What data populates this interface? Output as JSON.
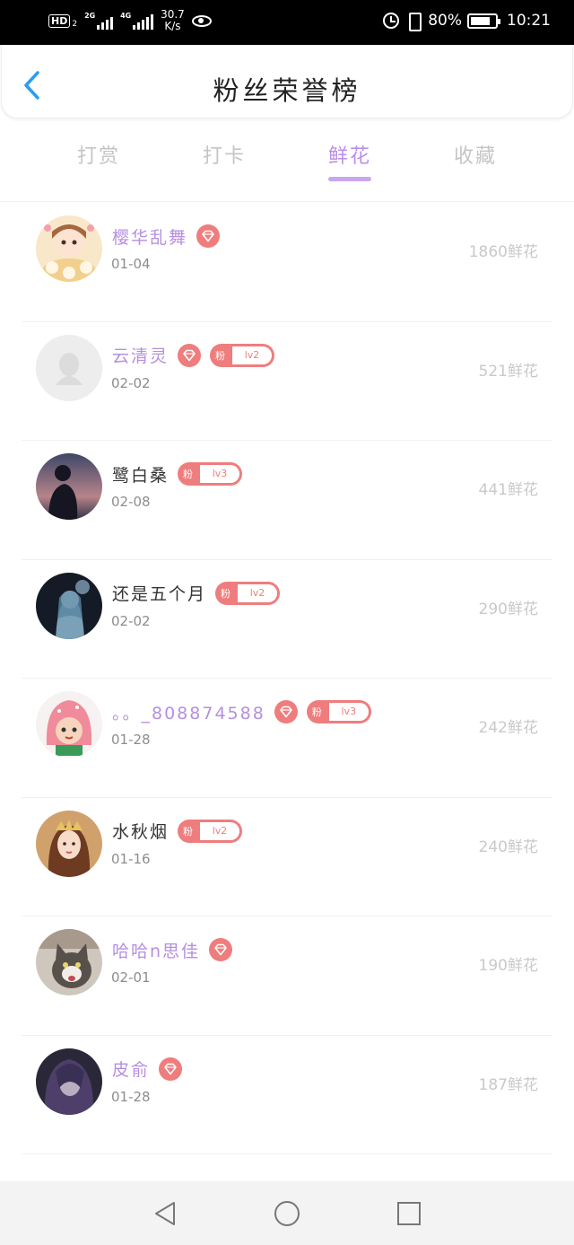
{
  "status_bar": {
    "hd": "HD",
    "sim2": "2",
    "net1": "2G",
    "net2": "4G",
    "speed_value": "30.7",
    "speed_unit": "K/s",
    "battery_pct": "80%",
    "battery_level": 0.8,
    "time": "10:21"
  },
  "header": {
    "title": "粉丝荣誉榜",
    "back_icon": "chevron-left-icon"
  },
  "tabs": [
    {
      "label": "打赏",
      "active": false
    },
    {
      "label": "打卡",
      "active": false
    },
    {
      "label": "鲜花",
      "active": true
    },
    {
      "label": "收藏",
      "active": false
    }
  ],
  "colors": {
    "accent_purple": "#b58fe0",
    "tab_indicator": "#c8a7ef",
    "badge_red": "#ef7d7d",
    "muted_gray": "#c9c9c9"
  },
  "fans": [
    {
      "name": "樱华乱舞",
      "name_color": "purple",
      "diamond": true,
      "fan_level": null,
      "date": "01-04",
      "count": "1860鲜花",
      "avatar": "cartoon-girl-avatar"
    },
    {
      "name": "云清灵",
      "name_color": "purple",
      "diamond": true,
      "fan_level": "lv2",
      "date": "02-02",
      "count": "521鲜花",
      "avatar": "default-penguin-avatar"
    },
    {
      "name": "鹭白桑",
      "name_color": "dark",
      "diamond": false,
      "fan_level": "lv3",
      "date": "02-08",
      "count": "441鲜花",
      "avatar": "sunset-silhouette-avatar"
    },
    {
      "name": "还是五个月",
      "name_color": "dark",
      "diamond": false,
      "fan_level": "lv2",
      "date": "02-02",
      "count": "290鲜花",
      "avatar": "anime-night-avatar"
    },
    {
      "name": "。。_808874588",
      "name_color": "purple",
      "diamond": true,
      "fan_level": "lv3",
      "date": "01-28",
      "count": "242鲜花",
      "avatar": "pink-hood-avatar"
    },
    {
      "name": "水秋烟",
      "name_color": "dark",
      "diamond": false,
      "fan_level": "lv2",
      "date": "01-16",
      "count": "240鲜花",
      "avatar": "crowned-lady-avatar"
    },
    {
      "name": "哈哈n思佳",
      "name_color": "purple",
      "diamond": true,
      "fan_level": null,
      "date": "02-01",
      "count": "190鲜花",
      "avatar": "cat-avatar"
    },
    {
      "name": "皮俞",
      "name_color": "purple",
      "diamond": true,
      "fan_level": null,
      "date": "01-28",
      "count": "187鲜花",
      "avatar": "dark-anime-avatar"
    }
  ],
  "fan_badge_prefix": "粉",
  "nav": {
    "back": "triangle-back-icon",
    "home": "circle-home-icon",
    "recents": "square-recents-icon"
  }
}
